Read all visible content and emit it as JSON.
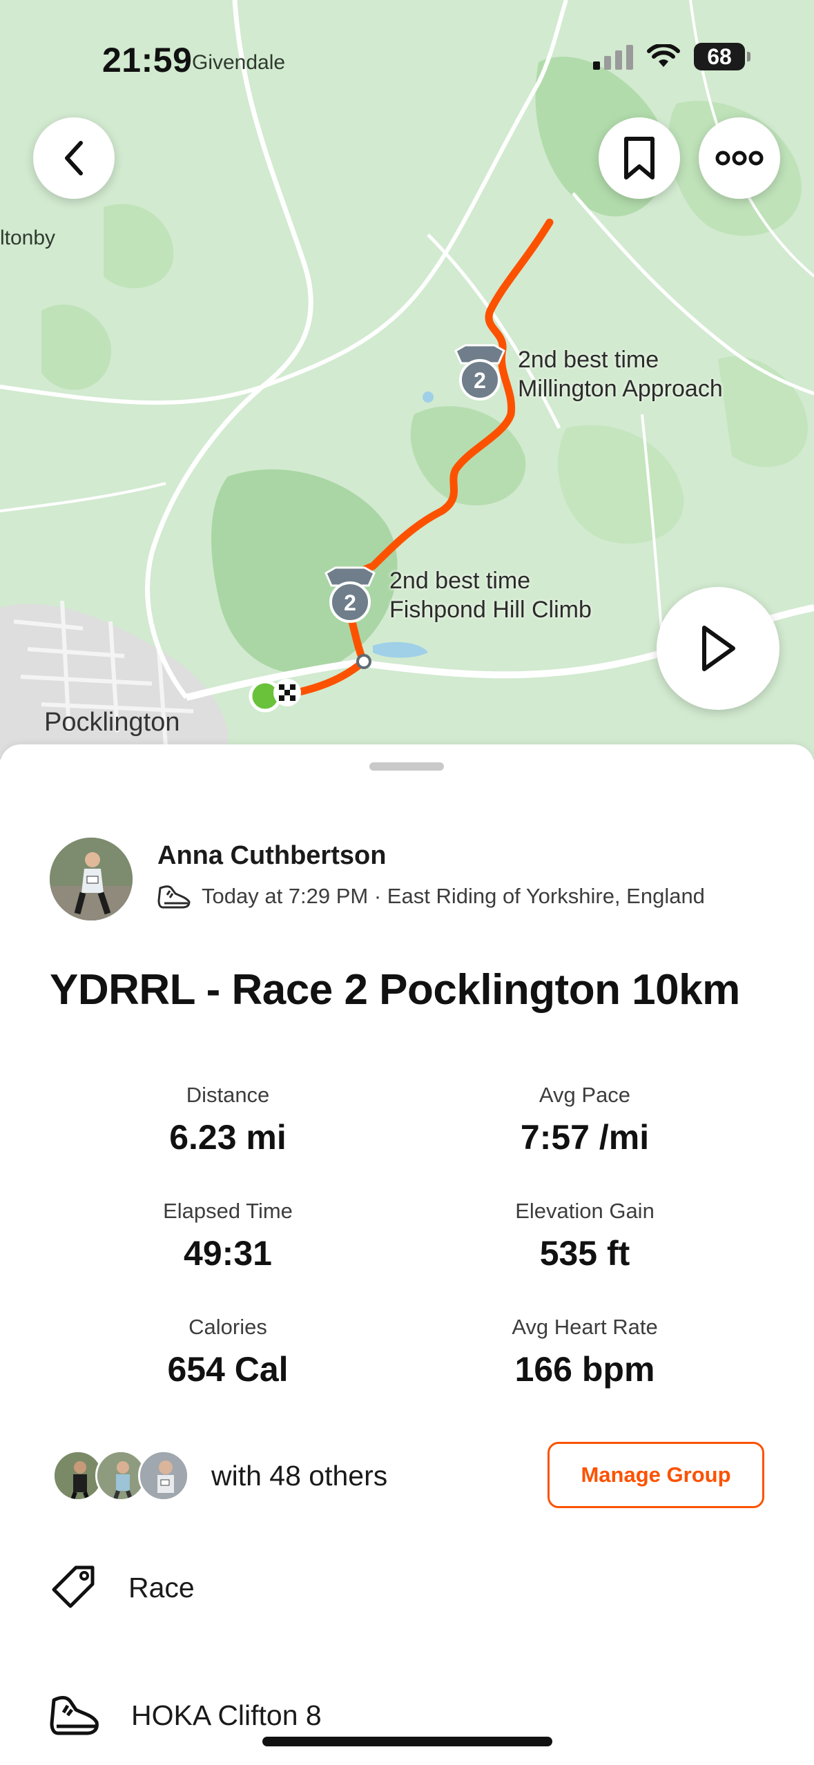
{
  "status_bar": {
    "time": "21:59",
    "battery": "68"
  },
  "map": {
    "labels": {
      "top": "Givendale",
      "left": "ltonby",
      "town": "Pocklington"
    },
    "segments": [
      {
        "line1": "2nd best time",
        "line2": "Millington Approach",
        "badge": "2"
      },
      {
        "line1": "2nd best time",
        "line2": "Fishpond Hill Climb",
        "badge": "2"
      }
    ],
    "route_color": "#fc5200"
  },
  "athlete": {
    "name": "Anna Cuthbertson",
    "meta": "Today at 7:29 PM · East Riding of Yorkshire, England"
  },
  "activity": {
    "title": "YDRRL - Race 2 Pocklington 10km"
  },
  "stats": [
    {
      "label": "Distance",
      "value": "6.23 mi"
    },
    {
      "label": "Avg Pace",
      "value": "7:57 /mi"
    },
    {
      "label": "Elapsed Time",
      "value": "49:31"
    },
    {
      "label": "Elevation Gain",
      "value": "535 ft"
    },
    {
      "label": "Calories",
      "value": "654 Cal"
    },
    {
      "label": "Avg Heart Rate",
      "value": "166 bpm"
    }
  ],
  "group": {
    "with_text": "with 48 others",
    "manage_label": "Manage Group"
  },
  "tags": {
    "race_label": "Race",
    "shoe_label": "HOKA Clifton 8"
  },
  "accent_color": "#fc5200"
}
